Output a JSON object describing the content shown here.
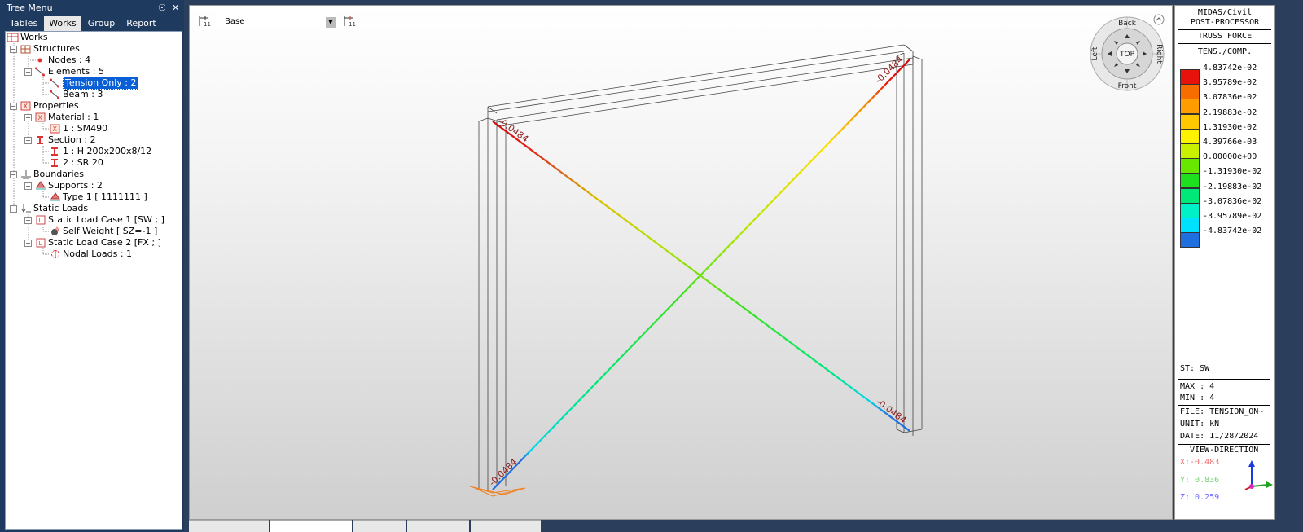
{
  "tree": {
    "title": "Tree Menu",
    "pin_glyph": "☉",
    "close_glyph": "✕",
    "tabs": [
      {
        "label": "Tables",
        "active": false
      },
      {
        "label": "Works",
        "active": true
      },
      {
        "label": "Group",
        "active": false
      },
      {
        "label": "Report",
        "active": false
      }
    ],
    "nodes": {
      "works": "Works",
      "structures": "Structures",
      "nodes": "Nodes : 4",
      "elements": "Elements : 5",
      "tension_only": "Tension Only : 2",
      "beam": "Beam : 3",
      "properties": "Properties",
      "material": "Material : 1",
      "material_1": "1 : SM490",
      "section": "Section : 2",
      "section_1": "1 : H 200x200x8/12",
      "section_2": "2 : SR 20",
      "boundaries": "Boundaries",
      "supports": "Supports : 2",
      "type1": "Type 1 [ 1111111 ]",
      "static_loads": "Static Loads",
      "load_case_1": "Static Load Case 1 [SW ; ]",
      "self_weight": "Self Weight [ SZ=-1 ]",
      "load_case_2": "Static Load Case 2 [FX ; ]",
      "nodal_loads": "Nodal Loads : 1"
    }
  },
  "viewport": {
    "view_select": "Base",
    "nav_cube": {
      "back": "Back",
      "front": "Front",
      "left": "Left",
      "right": "Right",
      "top": "TOP"
    },
    "element_labels": [
      "-0.0484",
      "-0.0484",
      "-0.0484",
      "-0.0484"
    ]
  },
  "legend": {
    "app": "MIDAS/Civil",
    "mode": "POST-PROCESSOR",
    "result": "TRUSS FORCE",
    "component": "TENS./COMP.",
    "scale": [
      {
        "color": "#e8120c",
        "value": "4.83742e-02"
      },
      {
        "color": "#f76d00",
        "value": "3.95789e-02"
      },
      {
        "color": "#ff9c00",
        "value": "3.07836e-02"
      },
      {
        "color": "#ffc800",
        "value": "2.19883e-02"
      },
      {
        "color": "#fff200",
        "value": "1.31930e-02"
      },
      {
        "color": "#c8f000",
        "value": "4.39766e-03"
      },
      {
        "color": "#68e800",
        "value": "0.00000e+00"
      },
      {
        "color": "#1ee01e",
        "value": "-1.31930e-02"
      },
      {
        "color": "#00e878",
        "value": "-2.19883e-02"
      },
      {
        "color": "#00f0c8",
        "value": "-3.07836e-02"
      },
      {
        "color": "#00e0ff",
        "value": "-3.95789e-02"
      },
      {
        "color": "#1f6fe0",
        "value": "-4.83742e-02"
      }
    ],
    "st": "ST: SW",
    "max": "MAX : 4",
    "min": "MIN : 4",
    "file": "FILE: TENSION_ON~",
    "unit": "UNIT: kN",
    "date": "DATE: 11/28/2024",
    "view_direction": "VIEW-DIRECTION",
    "x": "X:-0.483",
    "y": "Y: 0.836",
    "z": "Z: 0.259"
  }
}
